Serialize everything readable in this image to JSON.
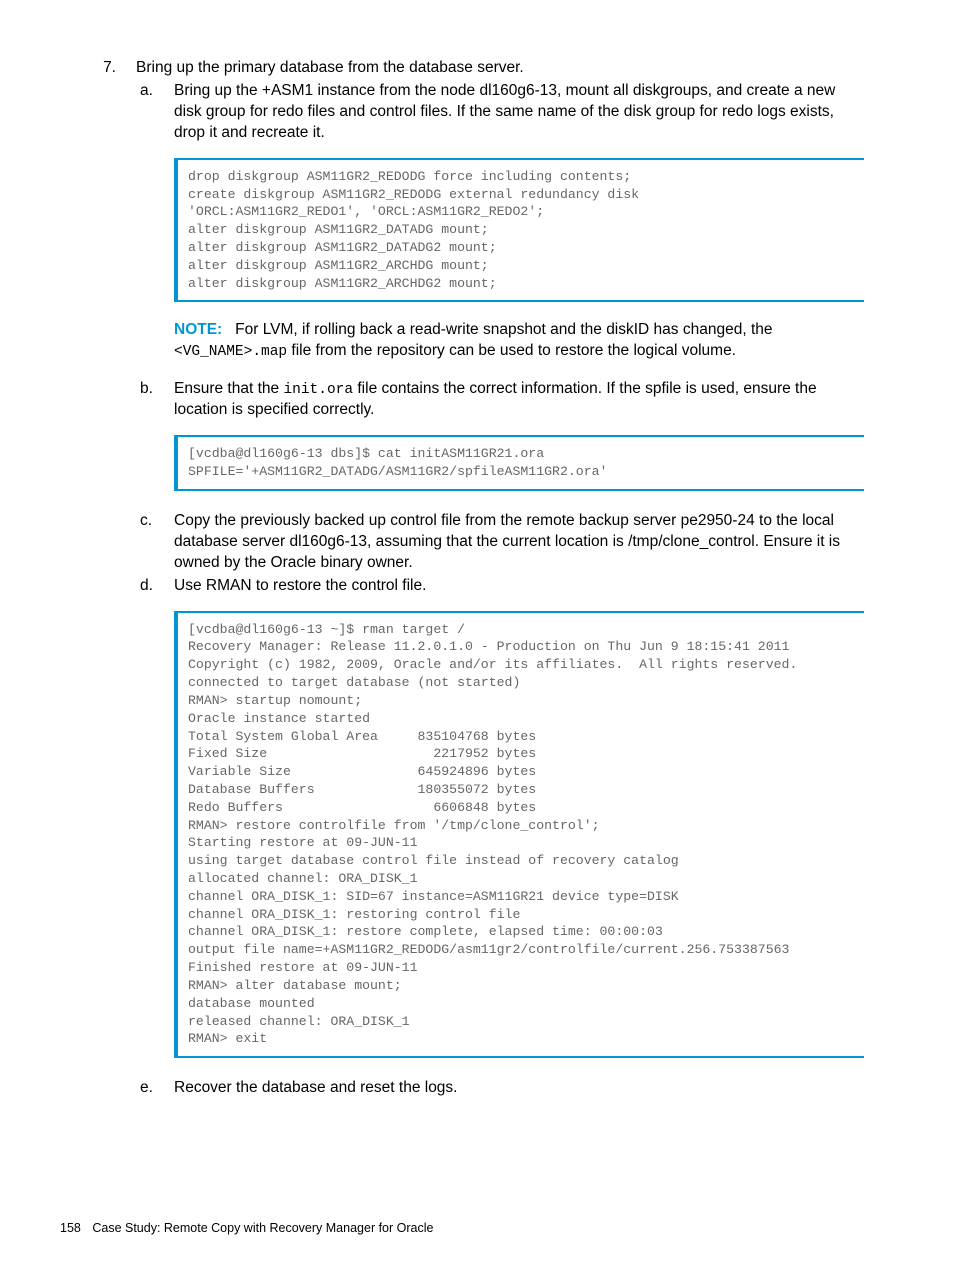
{
  "step7": {
    "number": "7.",
    "text": "Bring up the primary database from the database server.",
    "a": {
      "letter": "a.",
      "text": "Bring up the +ASM1 instance from the node dl160g6-13, mount all diskgroups, and create a new disk group for redo files and control files. If the same name of the disk group for redo logs exists, drop it and recreate it.",
      "code": "drop diskgroup ASM11GR2_REDODG force including contents;\ncreate diskgroup ASM11GR2_REDODG external redundancy disk\n'ORCL:ASM11GR2_REDO1', 'ORCL:ASM11GR2_REDO2';\nalter diskgroup ASM11GR2_DATADG mount;\nalter diskgroup ASM11GR2_DATADG2 mount;\nalter diskgroup ASM11GR2_ARCHDG mount;\nalter diskgroup ASM11GR2_ARCHDG2 mount;",
      "note_label": "NOTE:",
      "note_pre": "For LVM, if rolling back a read-write snapshot and the diskID has changed, the ",
      "note_code": "<VG_NAME>.map",
      "note_post": " file from the repository can be used to restore the logical volume."
    },
    "b": {
      "letter": "b.",
      "pre": "Ensure that the ",
      "code_inline": "init.ora",
      "post": " file contains the correct information. If the spfile is used, ensure the location is specified correctly.",
      "code": "[vcdba@dl160g6-13 dbs]$ cat initASM11GR21.ora\nSPFILE='+ASM11GR2_DATADG/ASM11GR2/spfileASM11GR2.ora'"
    },
    "c": {
      "letter": "c.",
      "text": "Copy the previously backed up control file from the remote backup server pe2950-24 to the local database server dl160g6-13, assuming that the current location is /tmp/clone_control. Ensure it is owned by the Oracle binary owner."
    },
    "d": {
      "letter": "d.",
      "text": "Use RMAN to restore the control file.",
      "code": "[vcdba@dl160g6-13 ~]$ rman target /\nRecovery Manager: Release 11.2.0.1.0 - Production on Thu Jun 9 18:15:41 2011\nCopyright (c) 1982, 2009, Oracle and/or its affiliates.  All rights reserved.\nconnected to target database (not started)\nRMAN> startup nomount;\nOracle instance started\nTotal System Global Area     835104768 bytes\nFixed Size                     2217952 bytes\nVariable Size                645924896 bytes\nDatabase Buffers             180355072 bytes\nRedo Buffers                   6606848 bytes\nRMAN> restore controlfile from '/tmp/clone_control';\nStarting restore at 09-JUN-11\nusing target database control file instead of recovery catalog\nallocated channel: ORA_DISK_1\nchannel ORA_DISK_1: SID=67 instance=ASM11GR21 device type=DISK\nchannel ORA_DISK_1: restoring control file\nchannel ORA_DISK_1: restore complete, elapsed time: 00:00:03\noutput file name=+ASM11GR2_REDODG/asm11gr2/controlfile/current.256.753387563\nFinished restore at 09-JUN-11\nRMAN> alter database mount;\ndatabase mounted\nreleased channel: ORA_DISK_1\nRMAN> exit"
    },
    "e": {
      "letter": "e.",
      "text": "Recover the database and reset the logs."
    }
  },
  "footer": {
    "page": "158",
    "title": "Case Study: Remote Copy with Recovery Manager for Oracle"
  }
}
